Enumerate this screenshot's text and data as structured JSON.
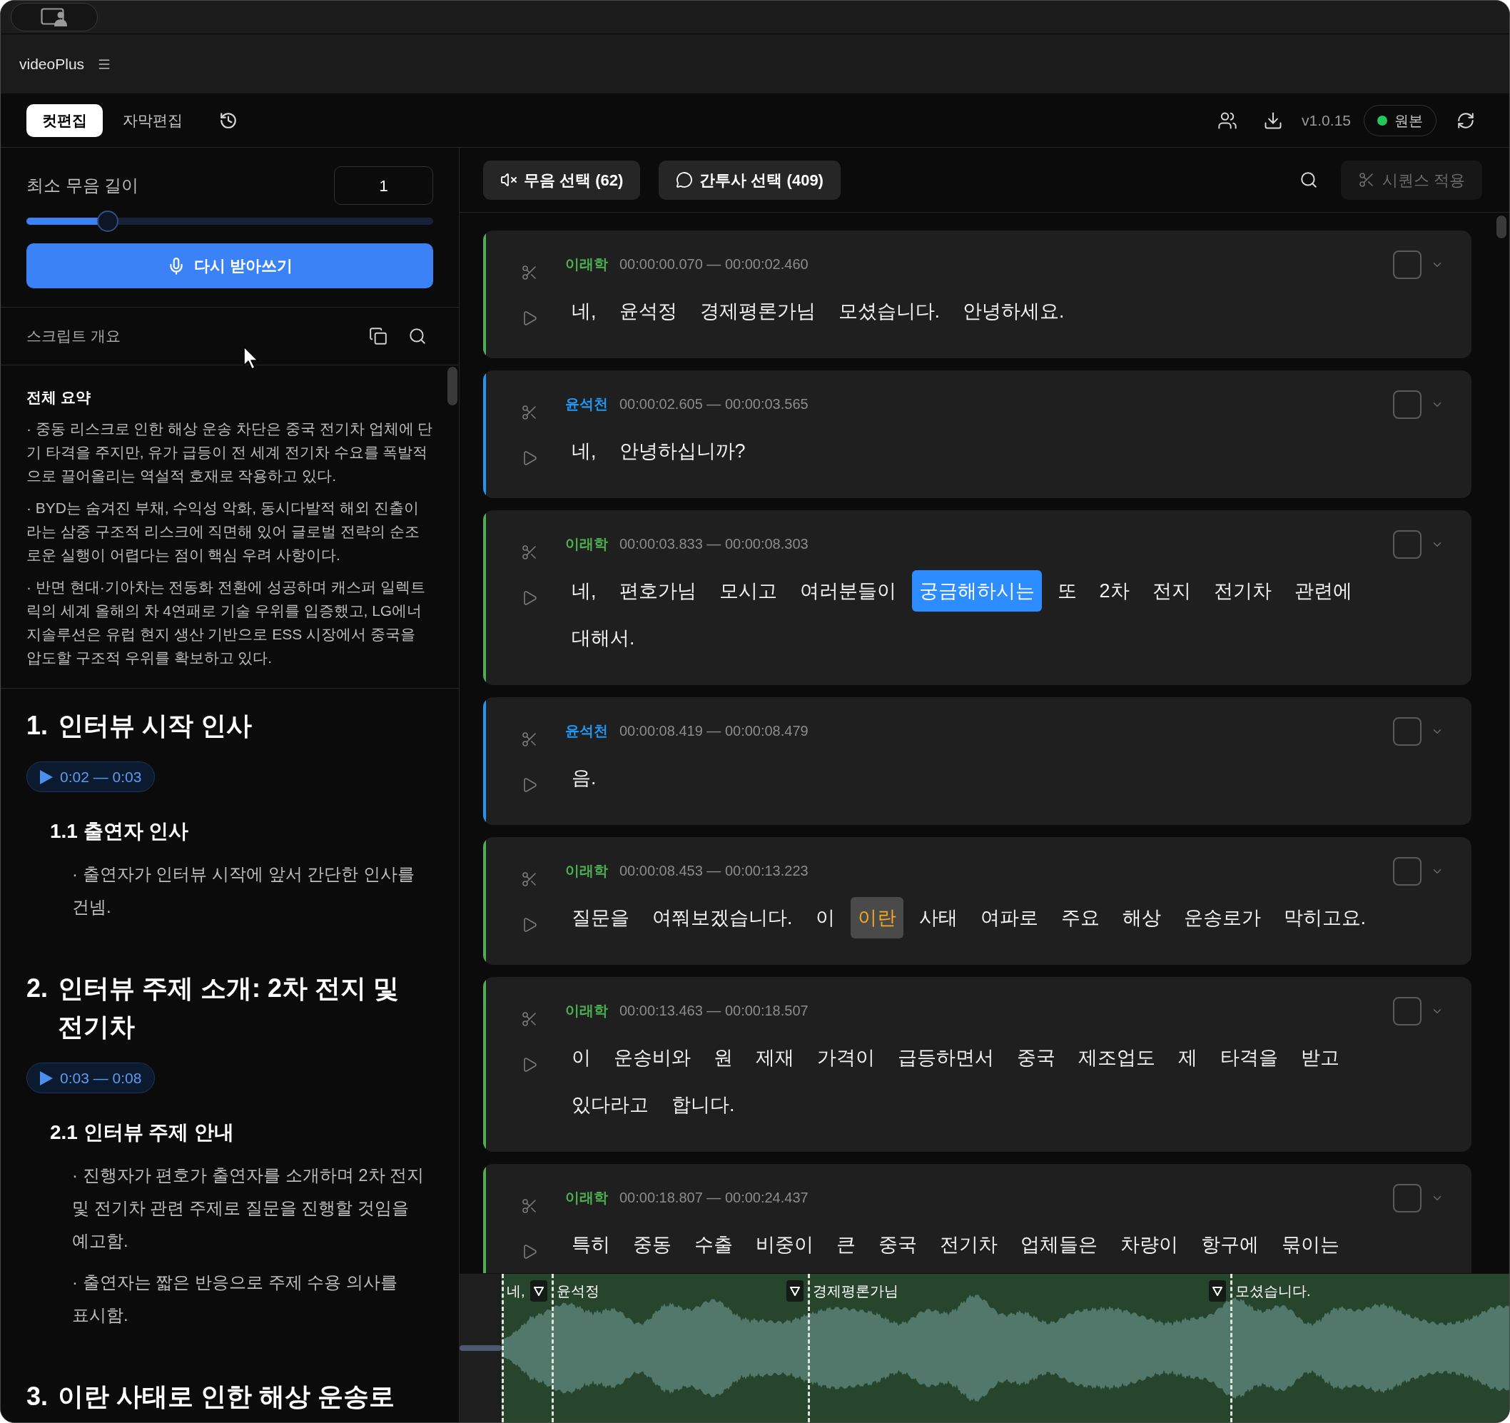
{
  "window": {
    "app_name": "videoPlus"
  },
  "tabs": [
    {
      "label": "컷편집",
      "selected": true
    },
    {
      "label": "자막편집",
      "selected": false
    }
  ],
  "header": {
    "version": "v1.0.15",
    "badge": {
      "label": "원본",
      "active": true
    }
  },
  "silence_panel": {
    "label": "최소 무음 길이",
    "value": "1",
    "level": 0.2,
    "button": "다시 받아쓰기"
  },
  "script_overview": {
    "title": "스크립트 개요"
  },
  "summary": {
    "title": "전체 요약",
    "bullets": [
      "· 중동 리스크로 인한 해상 운송 차단은 중국 전기차 업체에 단기 타격을 주지만, 유가 급등이 전 세계 전기차 수요를 폭발적으로 끌어올리는 역설적 호재로 작용하고 있다.",
      "· BYD는 숨겨진 부채, 수익성 악화, 동시다발적 해외 진출이라는 삼중 구조적 리스크에 직면해 있어 글로벌 전략의 순조로운 실행이 어렵다는 점이 핵심 우려 사항이다.",
      "· 반면 현대·기아차는 전동화 전환에 성공하며 캐스퍼 일렉트릭의 세계 올해의 차 4연패로 기술 우위를 입증했고, LG에너지솔루션은 유럽 현지 생산 기반으로 ESS 시장에서 중국을 압도할 구조적 우위를 확보하고 있다."
    ]
  },
  "outline": [
    {
      "number": "1.",
      "title": "인터뷰 시작 인사",
      "time": "0:02 — 0:03",
      "children": [
        {
          "title": "1.1 출연자 인사",
          "bullets": [
            "· 출연자가 인터뷰 시작에 앞서 간단한 인사를 건넴."
          ]
        }
      ]
    },
    {
      "number": "2.",
      "title": "인터뷰 주제 소개: 2차 전지 및 전기차",
      "time": "0:03 — 0:08",
      "children": [
        {
          "title": "2.1 인터뷰 주제 안내",
          "bullets": [
            "· 진행자가 편호가 출연자를 소개하며 2차 전지 및 전기차 관련 주제로 질문을 진행할 것임을 예고함.",
            "· 출연자는 짧은 반응으로 주제 수용 의사를 표시함."
          ]
        }
      ]
    },
    {
      "number": "3.",
      "title": "이란 사태로 인한 해상 운송로"
    }
  ],
  "toolbar": {
    "filters": [
      {
        "kind": "silence",
        "label": "무음 선택 (62)"
      },
      {
        "kind": "filler",
        "label": "간투사 선택 (409)"
      }
    ],
    "apply": {
      "label": "시퀀스 적용",
      "disabled": true
    }
  },
  "segments": [
    {
      "speaker": "이래학",
      "color": "#4caf50",
      "time": "00:00:00.070 — 00:00:02.460",
      "checked": false,
      "words": [
        {
          "text": "네,",
          "kind": "plain"
        },
        {
          "text": "윤석정",
          "kind": "plain"
        },
        {
          "text": "경제평론가님",
          "kind": "plain"
        },
        {
          "text": "모셨습니다.",
          "kind": "plain"
        },
        {
          "text": "안녕하세요.",
          "kind": "plain"
        }
      ]
    },
    {
      "speaker": "윤석천",
      "color": "#2196f3",
      "time": "00:00:02.605 — 00:00:03.565",
      "checked": false,
      "words": [
        {
          "text": "네,",
          "kind": "plain"
        },
        {
          "text": "안녕하십니까?",
          "kind": "plain"
        }
      ]
    },
    {
      "speaker": "이래학",
      "color": "#4caf50",
      "time": "00:00:03.833 — 00:00:08.303",
      "checked": false,
      "words": [
        {
          "text": "네,",
          "kind": "plain"
        },
        {
          "text": "편호가님",
          "kind": "plain"
        },
        {
          "text": "모시고",
          "kind": "plain"
        },
        {
          "text": "여러분들이",
          "kind": "plain"
        },
        {
          "text": "궁금해하시는",
          "kind": "current"
        },
        {
          "text": "또",
          "kind": "plain"
        },
        {
          "text": "2차",
          "kind": "plain"
        },
        {
          "text": "전지",
          "kind": "plain"
        },
        {
          "text": "전기차",
          "kind": "plain"
        },
        {
          "text": "관련에",
          "kind": "plain"
        },
        {
          "text": "대해서.",
          "kind": "plain"
        }
      ]
    },
    {
      "speaker": "윤석천",
      "color": "#2196f3",
      "time": "00:00:08.419 — 00:00:08.479",
      "checked": false,
      "words": [
        {
          "text": "음.",
          "kind": "plain"
        }
      ]
    },
    {
      "speaker": "이래학",
      "color": "#4caf50",
      "time": "00:00:08.453 — 00:00:13.223",
      "checked": false,
      "words": [
        {
          "text": "질문을",
          "kind": "plain"
        },
        {
          "text": "여쭤보겠습니다.",
          "kind": "plain"
        },
        {
          "text": "이",
          "kind": "plain"
        },
        {
          "text": "이란",
          "kind": "filler"
        },
        {
          "text": "사태",
          "kind": "plain"
        },
        {
          "text": "여파로",
          "kind": "plain"
        },
        {
          "text": "주요",
          "kind": "plain"
        },
        {
          "text": "해상",
          "kind": "plain"
        },
        {
          "text": "운송로가",
          "kind": "plain"
        },
        {
          "text": "막히고요.",
          "kind": "plain"
        }
      ]
    },
    {
      "speaker": "이래학",
      "color": "#4caf50",
      "time": "00:00:13.463 — 00:00:18.507",
      "checked": false,
      "words": [
        {
          "text": "이",
          "kind": "plain"
        },
        {
          "text": "운송비와",
          "kind": "plain"
        },
        {
          "text": "원",
          "kind": "plain"
        },
        {
          "text": "제재",
          "kind": "plain"
        },
        {
          "text": "가격이",
          "kind": "plain"
        },
        {
          "text": "급등하면서",
          "kind": "plain"
        },
        {
          "text": "중국",
          "kind": "plain"
        },
        {
          "text": "제조업도",
          "kind": "plain"
        },
        {
          "text": "제",
          "kind": "plain"
        },
        {
          "text": "타격을",
          "kind": "plain"
        },
        {
          "text": "받고",
          "kind": "plain"
        },
        {
          "text": "있다라고",
          "kind": "plain"
        },
        {
          "text": "합니다.",
          "kind": "plain"
        }
      ]
    },
    {
      "speaker": "이래학",
      "color": "#4caf50",
      "time": "00:00:18.807 — 00:00:24.437",
      "checked": false,
      "words": [
        {
          "text": "특히",
          "kind": "plain"
        },
        {
          "text": "중동",
          "kind": "plain"
        },
        {
          "text": "수출",
          "kind": "plain"
        },
        {
          "text": "비중이",
          "kind": "plain"
        },
        {
          "text": "큰",
          "kind": "plain"
        },
        {
          "text": "중국",
          "kind": "plain"
        },
        {
          "text": "전기차",
          "kind": "plain"
        },
        {
          "text": "업체들은",
          "kind": "plain"
        },
        {
          "text": "차량이",
          "kind": "plain"
        },
        {
          "text": "항구에",
          "kind": "plain"
        },
        {
          "text": "묶이는",
          "kind": "plain"
        }
      ]
    }
  ],
  "waveform": {
    "words": [
      {
        "text": "네,",
        "marker": false
      },
      {
        "text": "윤석정",
        "marker": true
      },
      {
        "text": "경제평론가님",
        "marker": true
      },
      {
        "text": "모셨습니다.",
        "marker": true
      }
    ]
  }
}
